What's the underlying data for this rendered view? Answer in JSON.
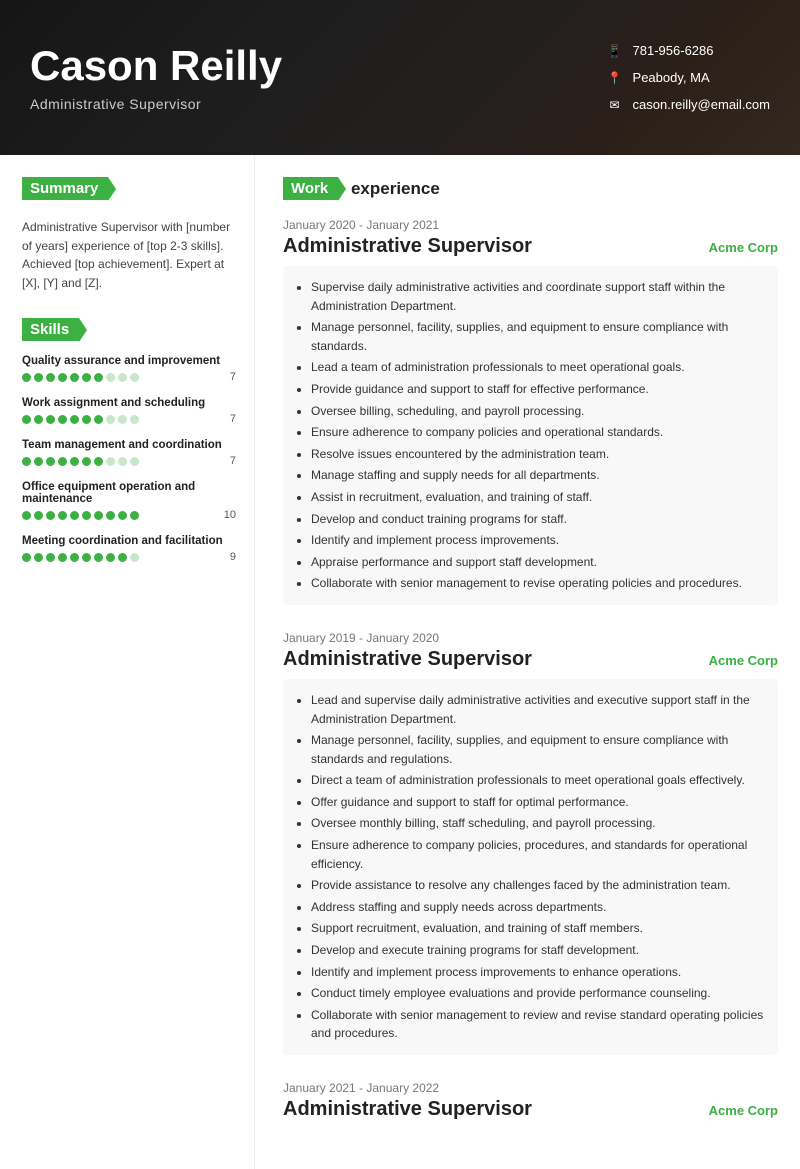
{
  "header": {
    "name": "Cason Reilly",
    "title": "Administrative Supervisor",
    "phone": "781-956-6286",
    "location": "Peabody, MA",
    "email": "cason.reilly@email.com"
  },
  "sidebar": {
    "summary_label": "Summary",
    "summary_text": "Administrative Supervisor with [number of years] experience of [top 2-3 skills]. Achieved [top achievement]. Expert at [X], [Y] and [Z].",
    "skills_label": "Skills",
    "skills": [
      {
        "name": "Quality assurance and improvement",
        "score": 7,
        "filled": 7,
        "total": 10
      },
      {
        "name": "Work assignment and scheduling",
        "score": 7,
        "filled": 7,
        "total": 10
      },
      {
        "name": "Team management and coordination",
        "score": 7,
        "filled": 7,
        "total": 10
      },
      {
        "name": "Office equipment operation and maintenance",
        "score": 10,
        "filled": 10,
        "total": 10
      },
      {
        "name": "Meeting coordination and facilitation",
        "score": 9,
        "filled": 9,
        "total": 10
      }
    ]
  },
  "work": {
    "section_label": "Work experience",
    "jobs": [
      {
        "date": "January 2020 - January 2021",
        "title": "Administrative Supervisor",
        "company": "Acme Corp",
        "bullets": [
          "Supervise daily administrative activities and coordinate support staff within the Administration Department.",
          "Manage personnel, facility, supplies, and equipment to ensure compliance with standards.",
          "Lead a team of administration professionals to meet operational goals.",
          "Provide guidance and support to staff for effective performance.",
          "Oversee billing, scheduling, and payroll processing.",
          "Ensure adherence to company policies and operational standards.",
          "Resolve issues encountered by the administration team.",
          "Manage staffing and supply needs for all departments.",
          "Assist in recruitment, evaluation, and training of staff.",
          "Develop and conduct training programs for staff.",
          "Identify and implement process improvements.",
          "Appraise performance and support staff development.",
          "Collaborate with senior management to revise operating policies and procedures."
        ]
      },
      {
        "date": "January 2019 - January 2020",
        "title": "Administrative Supervisor",
        "company": "Acme Corp",
        "bullets": [
          "Lead and supervise daily administrative activities and executive support staff in the Administration Department.",
          "Manage personnel, facility, supplies, and equipment to ensure compliance with standards and regulations.",
          "Direct a team of administration professionals to meet operational goals effectively.",
          "Offer guidance and support to staff for optimal performance.",
          "Oversee monthly billing, staff scheduling, and payroll processing.",
          "Ensure adherence to company policies, procedures, and standards for operational efficiency.",
          "Provide assistance to resolve any challenges faced by the administration team.",
          "Address staffing and supply needs across departments.",
          "Support recruitment, evaluation, and training of staff members.",
          "Develop and execute training programs for staff development.",
          "Identify and implement process improvements to enhance operations.",
          "Conduct timely employee evaluations and provide performance counseling.",
          "Collaborate with senior management to review and revise standard operating policies and procedures."
        ]
      },
      {
        "date": "January 2021 - January 2022",
        "title": "Administrative Supervisor",
        "company": "Acme Corp",
        "bullets": []
      }
    ]
  }
}
